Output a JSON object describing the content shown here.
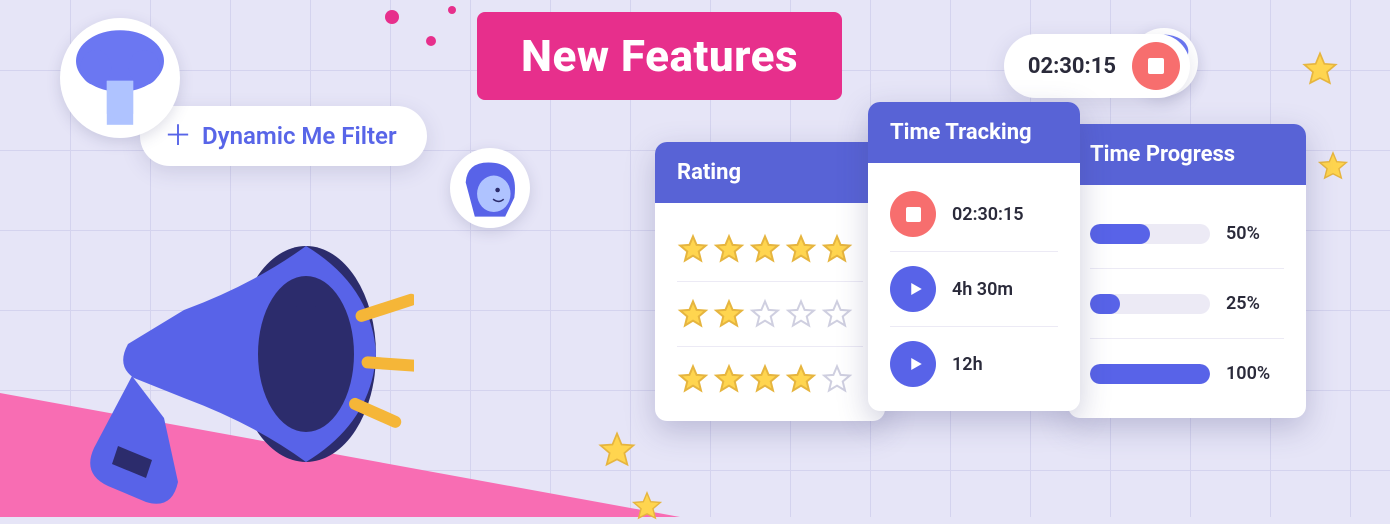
{
  "hero": {
    "title": "New Features"
  },
  "filter": {
    "label": "Dynamic Me Filter"
  },
  "timer_pill": {
    "time": "02:30:15"
  },
  "colors": {
    "accent_pink": "#E72F8C",
    "accent_blue": "#5863D6",
    "accent_coral": "#F76E6E",
    "star_fill": "#FFD54F"
  },
  "cards": {
    "rating": {
      "title": "Rating",
      "rows": [
        {
          "stars": 5,
          "max": 5
        },
        {
          "stars": 2,
          "max": 5
        },
        {
          "stars": 4,
          "max": 5
        }
      ]
    },
    "tracking": {
      "title": "Time Tracking",
      "rows": [
        {
          "icon": "stop",
          "value": "02:30:15"
        },
        {
          "icon": "play",
          "value": "4h 30m"
        },
        {
          "icon": "play",
          "value": "12h"
        }
      ]
    },
    "progress": {
      "title": "Time Progress",
      "rows": [
        {
          "percent": 50,
          "label": "50%"
        },
        {
          "percent": 25,
          "label": "25%"
        },
        {
          "percent": 100,
          "label": "100%"
        }
      ]
    }
  }
}
